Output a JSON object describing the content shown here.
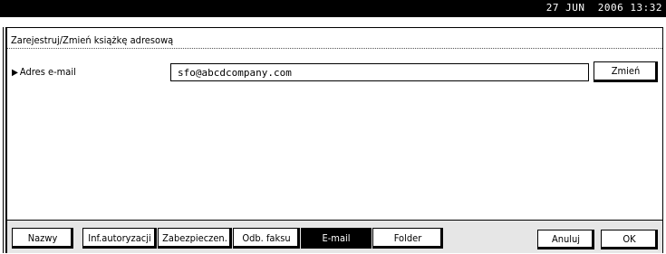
{
  "header": {
    "datetime": "27 JUN  2006 13:32"
  },
  "dialog": {
    "title": "Zarejestruj/Zmień książkę adresową"
  },
  "email": {
    "label": "Adres e-mail",
    "value": "sfo@abcdcompany.com",
    "change_label": "Zmień"
  },
  "tabs": [
    {
      "label": "Nazwy",
      "active": false
    },
    {
      "label": "Inf.autoryzacji",
      "active": false
    },
    {
      "label": "Zabezpieczen.",
      "active": false
    },
    {
      "label": "Odb. faksu",
      "active": false
    },
    {
      "label": "E-mail",
      "active": true
    },
    {
      "label": "Folder",
      "active": false
    }
  ],
  "actions": {
    "cancel_label": "Anuluj",
    "ok_label": "OK"
  }
}
